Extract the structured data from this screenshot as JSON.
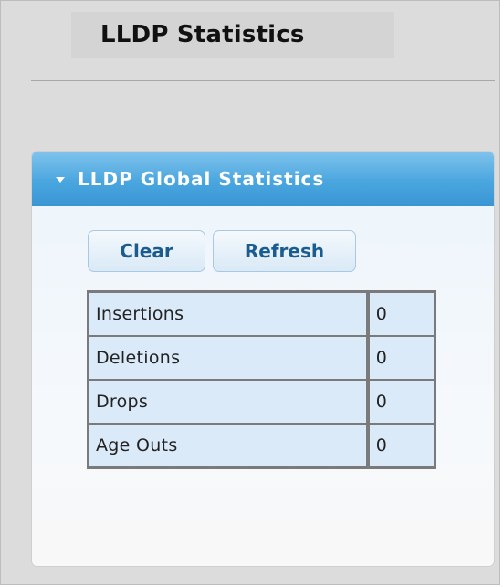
{
  "page": {
    "title": "LLDP Statistics"
  },
  "panel": {
    "title": "LLDP Global Statistics"
  },
  "buttons": {
    "clear": "Clear",
    "refresh": "Refresh"
  },
  "stats": [
    {
      "label": "Insertions",
      "value": "0"
    },
    {
      "label": "Deletions",
      "value": "0"
    },
    {
      "label": "Drops",
      "value": "0"
    },
    {
      "label": "Age Outs",
      "value": "0"
    }
  ]
}
